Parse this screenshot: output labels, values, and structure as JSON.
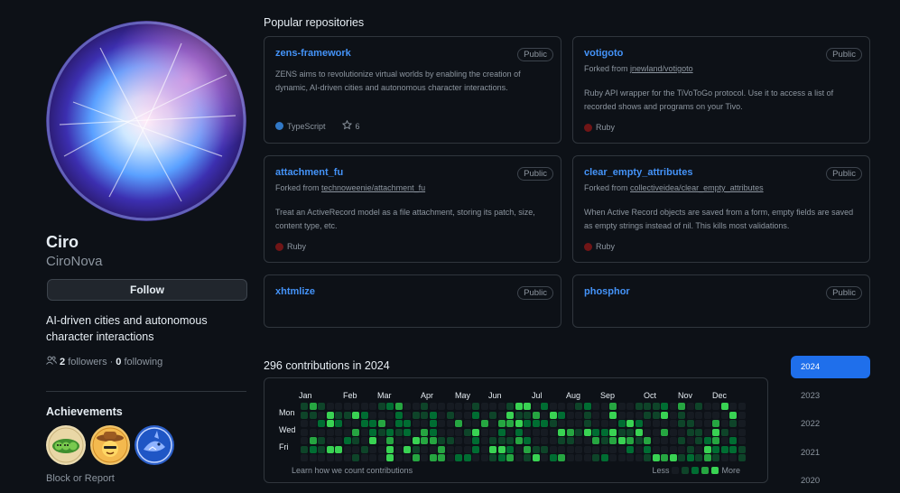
{
  "profile": {
    "name": "Ciro",
    "login": "CiroNova",
    "follow_label": "Follow",
    "bio": "AI-driven cities and autonomous character interactions",
    "followers_count": "2",
    "followers_label": "followers",
    "separator": "·",
    "following_count": "0",
    "following_label": "following",
    "achievements_title": "Achievements",
    "block_label": "Block or Report"
  },
  "badges": [
    {
      "name": "pair-extraordinaire",
      "icon": "peas-icon",
      "color": "#3a8a3a"
    },
    {
      "name": "yolo",
      "icon": "cowboy-face-icon",
      "color": "#d7892a"
    },
    {
      "name": "quickdraw",
      "icon": "shark-icon",
      "color": "#2f6fd1"
    }
  ],
  "popular": {
    "title": "Popular repositories",
    "repos": [
      {
        "name": "zens-framework",
        "visibility": "Public",
        "forked_from": "",
        "description": "ZENS aims to revolutionize virtual worlds by enabling the creation of dynamic, AI-driven cities and autonomous character interactions.",
        "language": "TypeScript",
        "lang_color": "#3178c6",
        "stars": "6"
      },
      {
        "name": "votigoto",
        "visibility": "Public",
        "forked_label": "Forked from",
        "forked_from": "jnewland/votigoto",
        "description": "Ruby API wrapper for the TiVoToGo protocol. Use it to access a list of recorded shows and programs on your Tivo.",
        "language": "Ruby",
        "lang_color": "#701516"
      },
      {
        "name": "attachment_fu",
        "visibility": "Public",
        "forked_label": "Forked from",
        "forked_from": "technoweenie/attachment_fu",
        "description": "Treat an ActiveRecord model as a file attachment, storing its patch, size, content type, etc.",
        "language": "Ruby",
        "lang_color": "#701516"
      },
      {
        "name": "clear_empty_attributes",
        "visibility": "Public",
        "forked_label": "Forked from",
        "forked_from": "collectiveidea/clear_empty_attributes",
        "description": "When Active Record objects are saved from a form, empty fields are saved as empty strings instead of nil. This kills most validations.",
        "language": "Ruby",
        "lang_color": "#701516"
      },
      {
        "name": "xhtmlize",
        "visibility": "Public"
      },
      {
        "name": "phosphor",
        "visibility": "Public"
      }
    ]
  },
  "contributions": {
    "title": "296 contributions in 2024",
    "months": [
      "Jan",
      "Feb",
      "Mar",
      "Apr",
      "May",
      "Jun",
      "Jul",
      "Aug",
      "Sep",
      "Oct",
      "Nov",
      "Dec"
    ],
    "days": [
      "Mon",
      "Wed",
      "Fri"
    ],
    "learn_label": "Learn how we count contributions",
    "less_label": "Less",
    "more_label": "More",
    "level_colors": [
      "#161b22",
      "#0e4429",
      "#006d32",
      "#26a641",
      "#39d353"
    ]
  },
  "years": [
    "2024",
    "2023",
    "2022",
    "2021",
    "2020"
  ],
  "selected_year": "2024"
}
